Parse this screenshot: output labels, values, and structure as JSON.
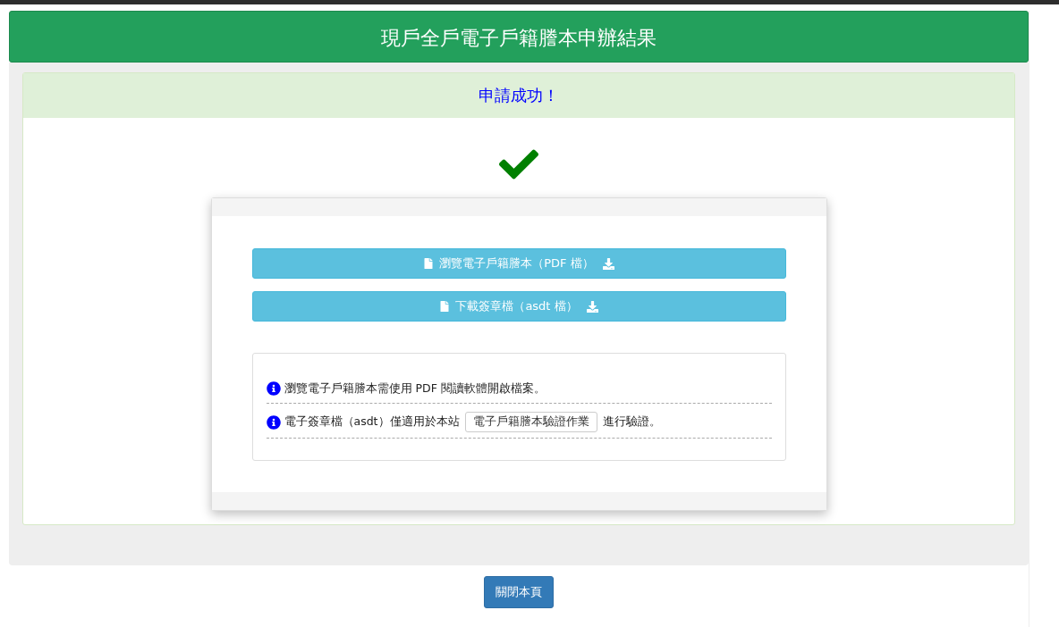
{
  "header": {
    "title": "現戶全戶電子戶籍謄本申辦結果"
  },
  "alert": {
    "message": "申請成功！"
  },
  "actions": [
    {
      "label": "瀏覽電子戶籍謄本（PDF 檔）"
    },
    {
      "label": "下載簽章檔（asdt 檔）"
    }
  ],
  "notes": [
    {
      "kind": "plain",
      "text": "瀏覽電子戶籍謄本需使用 PDF 閱讀軟體開啟檔案。"
    },
    {
      "kind": "link",
      "text": "電子簽章檔（asdt）僅適用於本站",
      "link": "電子戶籍謄本驗證作業",
      "after": "進行驗證。"
    }
  ],
  "close_button": "關閉本頁"
}
